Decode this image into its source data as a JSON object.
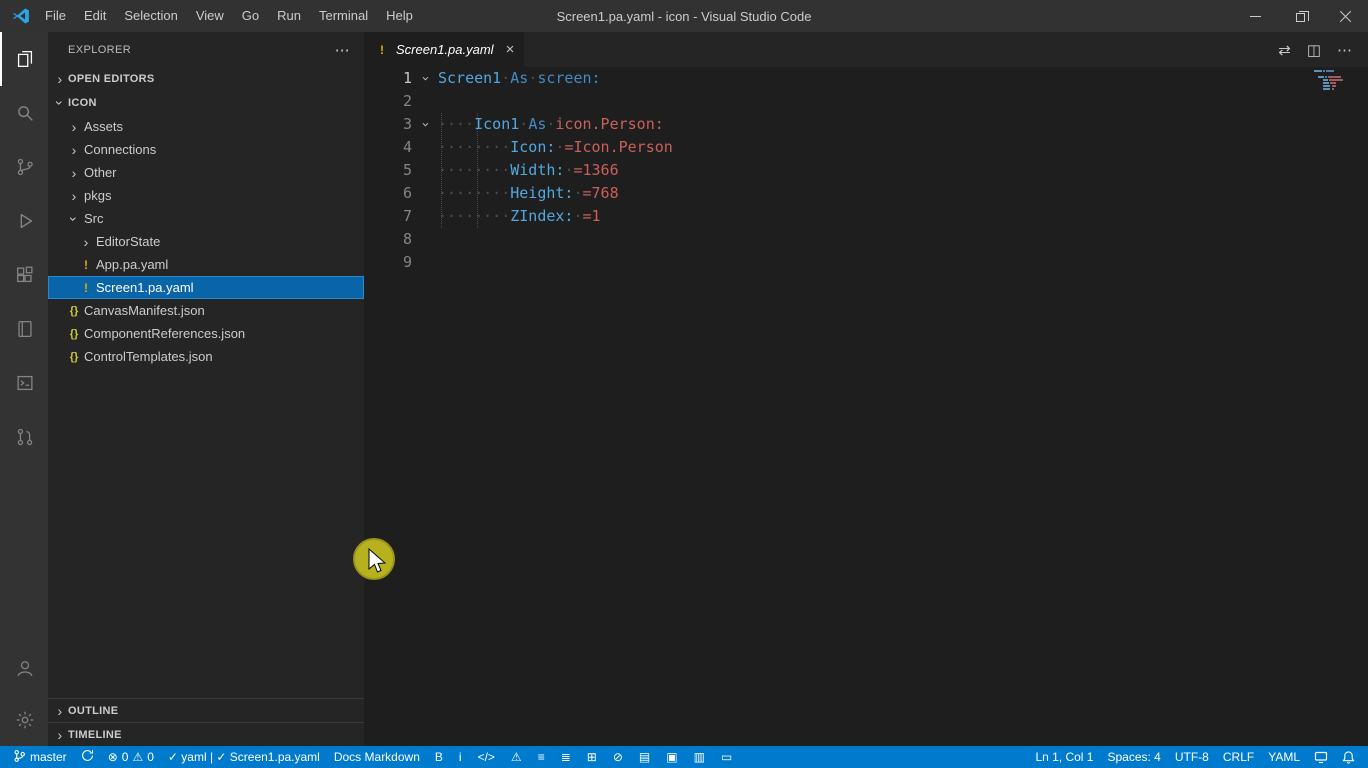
{
  "colors": {
    "accent": "#007acc",
    "selection": "#0a65a8",
    "syntax_key": "#52a7e0",
    "syntax_keyword": "#4489c8",
    "syntax_value": "#c9605a",
    "file_icon_yellow": "#ddb100"
  },
  "icons": {
    "chevron": "›",
    "more": "⋯",
    "yaml_file": "!",
    "json_file": "{}",
    "close_tab": "×",
    "open_changes": "⇄",
    "split_editor": "◫",
    "error": "⊗",
    "warning": "⚠"
  },
  "titlebar": {
    "menus": [
      "File",
      "Edit",
      "Selection",
      "View",
      "Go",
      "Run",
      "Terminal",
      "Help"
    ],
    "title": "Screen1.pa.yaml - icon - Visual Studio Code"
  },
  "activitybar": {
    "top": [
      {
        "name": "explorer",
        "active": true
      },
      {
        "name": "search"
      },
      {
        "name": "source-control"
      },
      {
        "name": "run-debug"
      },
      {
        "name": "extensions"
      },
      {
        "name": "docs"
      },
      {
        "name": "terminal-box"
      },
      {
        "name": "pull-request"
      }
    ],
    "bottom": [
      {
        "name": "account"
      },
      {
        "name": "settings"
      }
    ]
  },
  "sidebar": {
    "title": "EXPLORER",
    "sections": {
      "open_editors": "OPEN EDITORS",
      "project": "ICON",
      "outline": "OUTLINE",
      "timeline": "TIMELINE"
    },
    "tree": [
      {
        "label": "Assets",
        "indent": 1,
        "chevron": "collapsed"
      },
      {
        "label": "Connections",
        "indent": 1,
        "chevron": "collapsed"
      },
      {
        "label": "Other",
        "indent": 1,
        "chevron": "collapsed"
      },
      {
        "label": "pkgs",
        "indent": 1,
        "chevron": "collapsed"
      },
      {
        "label": "Src",
        "indent": 1,
        "chevron": "expanded"
      },
      {
        "label": "EditorState",
        "indent": 2,
        "chevron": "collapsed"
      },
      {
        "label": "App.pa.yaml",
        "indent": 2,
        "icon": "yaml"
      },
      {
        "label": "Screen1.pa.yaml",
        "indent": 2,
        "icon": "yaml",
        "selected": true
      },
      {
        "label": "CanvasManifest.json",
        "indent": 1,
        "icon": "json"
      },
      {
        "label": "ComponentReferences.json",
        "indent": 1,
        "icon": "json"
      },
      {
        "label": "ControlTemplates.json",
        "indent": 1,
        "icon": "json"
      }
    ]
  },
  "editor": {
    "tab": {
      "label": "Screen1.pa.yaml"
    },
    "active_line": 1,
    "lines": [
      {
        "num": 1,
        "fold": true,
        "tokens": [
          [
            "Screen1",
            "k"
          ],
          [
            "·",
            "w"
          ],
          [
            "As",
            "kw"
          ],
          [
            "·",
            "w"
          ],
          [
            "screen:",
            "kw"
          ]
        ]
      },
      {
        "num": 2,
        "tokens": []
      },
      {
        "num": 3,
        "fold": true,
        "tokens": [
          [
            "····",
            "w"
          ],
          [
            "Icon1",
            "k"
          ],
          [
            "·",
            "w"
          ],
          [
            "As",
            "kw"
          ],
          [
            "·",
            "w"
          ],
          [
            "icon.Person:",
            "v"
          ]
        ]
      },
      {
        "num": 4,
        "tokens": [
          [
            "········",
            "w"
          ],
          [
            "Icon:",
            "k"
          ],
          [
            "·",
            "w"
          ],
          [
            "=Icon.Person",
            "v"
          ]
        ]
      },
      {
        "num": 5,
        "tokens": [
          [
            "········",
            "w"
          ],
          [
            "Width:",
            "k"
          ],
          [
            "·",
            "w"
          ],
          [
            "=1366",
            "v"
          ]
        ]
      },
      {
        "num": 6,
        "tokens": [
          [
            "········",
            "w"
          ],
          [
            "Height:",
            "k"
          ],
          [
            "·",
            "w"
          ],
          [
            "=768",
            "v"
          ]
        ]
      },
      {
        "num": 7,
        "tokens": [
          [
            "········",
            "w"
          ],
          [
            "ZIndex:",
            "k"
          ],
          [
            "·",
            "w"
          ],
          [
            "=1",
            "v"
          ]
        ]
      },
      {
        "num": 8,
        "tokens": []
      },
      {
        "num": 9,
        "tokens": []
      }
    ]
  },
  "statusbar": {
    "branch": "master",
    "errors": "0",
    "warnings": "0",
    "lang_status": "✓ yaml | ✓ Screen1.pa.yaml",
    "docs": "Docs Markdown",
    "tools": [
      "B",
      "i",
      "</>",
      "⚠",
      "≡",
      "≣",
      "⊞",
      "⊘",
      "▤",
      "▣",
      "▥",
      "▭"
    ],
    "tool_names": [
      "bold-icon",
      "italic-icon",
      "code-icon",
      "warning-icon",
      "ordered-list-icon",
      "unordered-list-icon",
      "insert-table-icon",
      "no-entry-icon",
      "save-file-icon",
      "shield-icon",
      "export-icon",
      "window-icon"
    ],
    "cursor": "Ln 1, Col 1",
    "indent": "Spaces: 4",
    "encoding": "UTF-8",
    "eol": "CRLF",
    "language": "YAML"
  }
}
